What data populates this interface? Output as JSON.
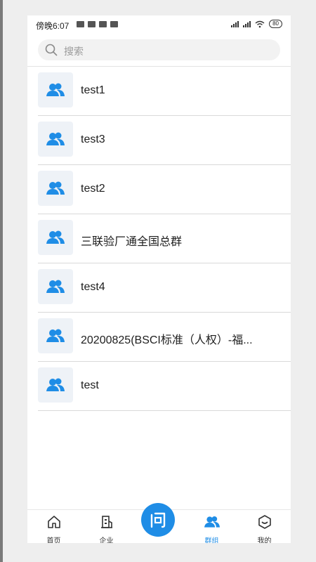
{
  "status_bar": {
    "time": "傍晚6:07",
    "battery": "80"
  },
  "search": {
    "placeholder": "搜索"
  },
  "groups": [
    {
      "name": "test1"
    },
    {
      "name": "test3"
    },
    {
      "name": "test2"
    },
    {
      "name": "三联验厂通全国总群"
    },
    {
      "name": "test4"
    },
    {
      "name": "20200825(BSCI标准（人权）-福..."
    },
    {
      "name": "test"
    }
  ],
  "tabbar": {
    "home": "首页",
    "company": "企业",
    "groups": "群组",
    "mine": "我的",
    "fab_label": "问"
  },
  "colors": {
    "accent": "#1f8de6",
    "avatar_bg": "#eef2f7"
  },
  "icons": {
    "group_avatar": "people-icon",
    "home": "home-icon",
    "company": "building-icon",
    "groups": "users-icon",
    "mine": "smile-icon",
    "fab": "question-icon",
    "search": "search-icon"
  }
}
